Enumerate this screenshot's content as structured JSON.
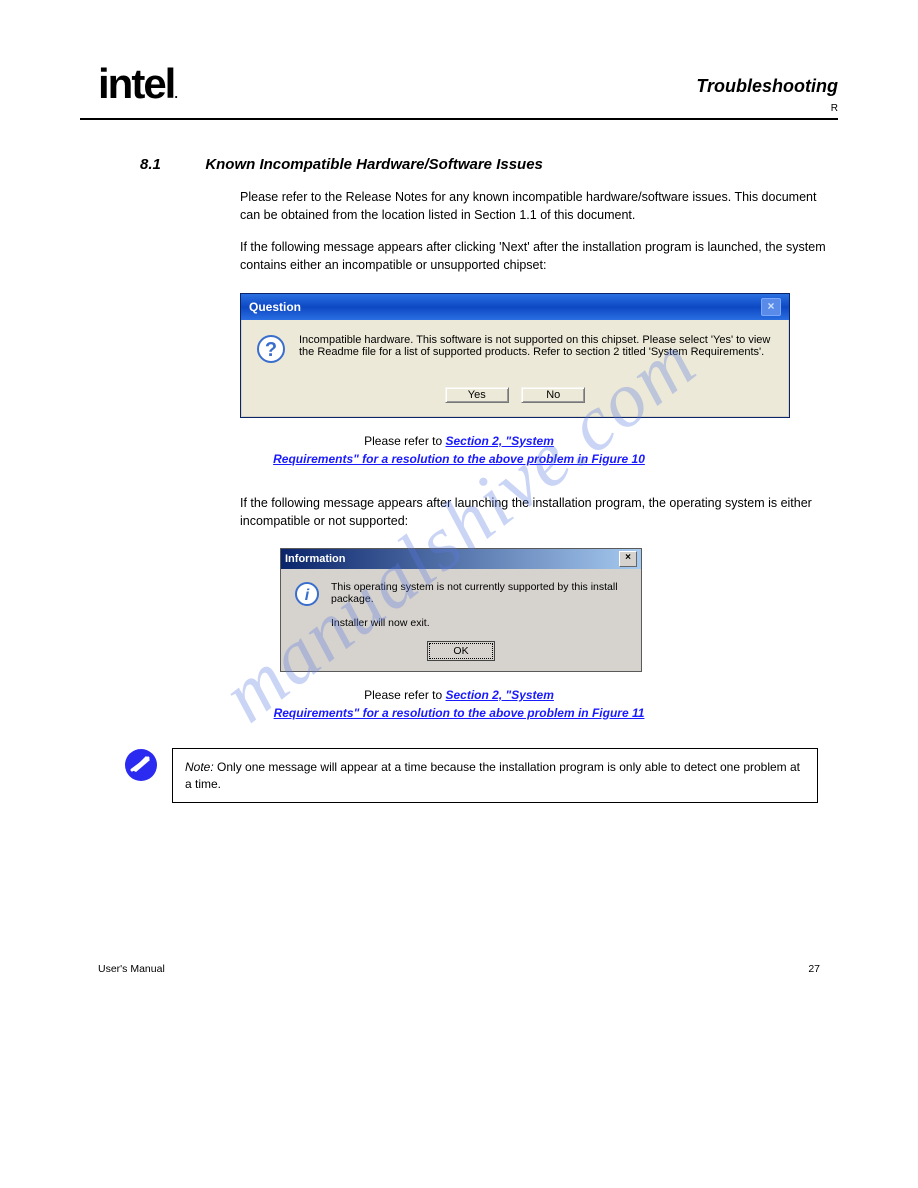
{
  "header": {
    "logo_text": "intel",
    "title": "Troubleshooting",
    "rmark": "R"
  },
  "section": {
    "number": "8.1",
    "title": "Known Incompatible Hardware/Software Issues",
    "p1": "Please refer to the Release Notes for any known incompatible hardware/software issues. This document can be obtained from the location listed in Section 1.1 of this document.",
    "p2": "If the following message appears after clicking 'Next' after the installation program is launched, the system contains either an incompatible or unsupported chipset:",
    "p3": "If the following message appears after launching the installation program, the operating system is either incompatible or not supported:"
  },
  "dialog1": {
    "title": "Question",
    "message": "Incompatible hardware. This software is not supported on this chipset.  Please select 'Yes' to view the Readme file for a list of supported products. Refer to section 2 titled 'System Requirements'.",
    "yes": "Yes",
    "no": "No"
  },
  "figure1": {
    "prefix": "Please refer to ",
    "link1": "Section 2, \"System",
    "line2": "Requirements\" for a resolution to the above problem in Figure 10"
  },
  "dialog2": {
    "title": "Information",
    "line1": "This operating system is not currently supported by this install package.",
    "line2": "Installer will now exit.",
    "ok": "OK"
  },
  "figure2": {
    "prefix": "Please refer to ",
    "link1": "Section 2, \"System",
    "line2": "Requirements\" for a resolution to the above problem in Figure 11"
  },
  "note": {
    "label": "Note:",
    "text": " Only one message will appear at a time because the installation program is only able to detect one problem at a time."
  },
  "footer": {
    "left": "User's Manual",
    "right": "27"
  },
  "watermark": "manualshive.com"
}
